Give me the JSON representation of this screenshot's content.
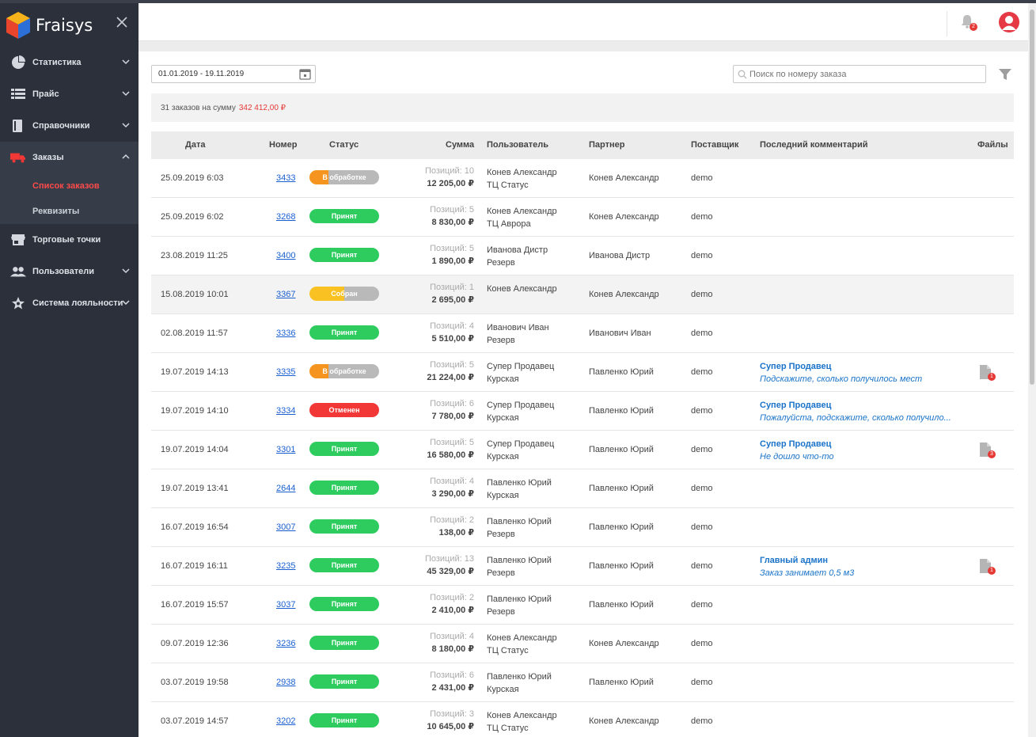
{
  "app": {
    "name": "Fraisys"
  },
  "colors": {
    "sidebar_bg": "#2b303b",
    "accent_red": "#e53935",
    "link_blue": "#1a5fd0",
    "status_green": "#2ecc5f",
    "status_red": "#f23737",
    "status_orange": "#f5941e",
    "status_yellow": "#f9c222"
  },
  "sidebar": {
    "items": [
      {
        "label": "Статистика",
        "icon": "pie-chart-icon"
      },
      {
        "label": "Прайс",
        "icon": "list-icon"
      },
      {
        "label": "Справочники",
        "icon": "book-icon"
      },
      {
        "label": "Заказы",
        "icon": "truck-icon"
      },
      {
        "label": "Торговые точки",
        "icon": "store-icon"
      },
      {
        "label": "Пользователи",
        "icon": "users-icon"
      },
      {
        "label": "Система лояльности",
        "icon": "star-icon"
      }
    ],
    "orders_sub": [
      {
        "label": "Список заказов"
      },
      {
        "label": "Реквизиты"
      }
    ]
  },
  "header": {
    "notification_count": "2"
  },
  "filters": {
    "date_range": "01.01.2019 - 19.11.2019",
    "search_placeholder": "Поиск по номеру заказа"
  },
  "summary": {
    "text": "31 заказов на сумму",
    "amount": "342 412,00 ₽"
  },
  "table": {
    "headers": {
      "date": "Дата",
      "number": "Номер",
      "status": "Статус",
      "sum": "Сумма",
      "user": "Пользователь",
      "partner": "Партнер",
      "supplier": "Поставщик",
      "comment": "Последний комментарий",
      "files": "Файлы"
    },
    "rows": [
      {
        "date": "25.09.2019 6:03",
        "number": "3433",
        "status": "В обработке",
        "status_type": "orange",
        "positions": "Позиций: 10",
        "sum": "12 205,00 ₽",
        "user": "Конев Александр",
        "user_store": "ТЦ Статус",
        "partner": "Конев Александр",
        "supplier": "demo",
        "comment_author": "",
        "comment_text": "",
        "files": ""
      },
      {
        "date": "25.09.2019 6:02",
        "number": "3268",
        "status": "Принят",
        "status_type": "green",
        "positions": "Позиций: 5",
        "sum": "8 830,00 ₽",
        "user": "Конев Александр",
        "user_store": "ТЦ Аврора",
        "partner": "Конев Александр",
        "supplier": "demo",
        "comment_author": "",
        "comment_text": "",
        "files": ""
      },
      {
        "date": "23.08.2019 11:25",
        "number": "3400",
        "status": "Принят",
        "status_type": "green",
        "positions": "Позиций: 5",
        "sum": "1 890,00 ₽",
        "user": "Иванова Дистр",
        "user_store": "Резерв",
        "partner": "Иванова Дистр",
        "supplier": "demo",
        "comment_author": "",
        "comment_text": "",
        "files": ""
      },
      {
        "date": "15.08.2019 10:01",
        "number": "3367",
        "status": "Собран",
        "status_type": "yellow",
        "positions": "Позиций: 1",
        "sum": "2 695,00 ₽",
        "user": "Конев Александр",
        "user_store": "",
        "partner": "Конев Александр",
        "supplier": "demo",
        "comment_author": "",
        "comment_text": "",
        "files": "",
        "hover": true
      },
      {
        "date": "02.08.2019 11:57",
        "number": "3336",
        "status": "Принят",
        "status_type": "green",
        "positions": "Позиций: 4",
        "sum": "5 510,00 ₽",
        "user": "Иванович Иван",
        "user_store": "Резерв",
        "partner": "Иванович Иван",
        "supplier": "demo",
        "comment_author": "",
        "comment_text": "",
        "files": ""
      },
      {
        "date": "19.07.2019 14:13",
        "number": "3335",
        "status": "В обработке",
        "status_type": "orange",
        "positions": "Позиций: 5",
        "sum": "21 224,00 ₽",
        "user": "Супер Продавец",
        "user_store": "Курская",
        "partner": "Павленко Юрий",
        "supplier": "demo",
        "comment_author": "Супер Продавец",
        "comment_text": "Подскажите, сколько получилось мест",
        "files": "1"
      },
      {
        "date": "19.07.2019 14:10",
        "number": "3334",
        "status": "Отменен",
        "status_type": "red",
        "positions": "Позиций: 6",
        "sum": "7 780,00 ₽",
        "user": "Супер Продавец",
        "user_store": "Курская",
        "partner": "Павленко Юрий",
        "supplier": "demo",
        "comment_author": "Супер Продавец",
        "comment_text": "Пожалуйста, подскажите, сколько получило...",
        "files": ""
      },
      {
        "date": "19.07.2019 14:04",
        "number": "3301",
        "status": "Принят",
        "status_type": "green",
        "positions": "Позиций: 5",
        "sum": "16 580,00 ₽",
        "user": "Супер Продавец",
        "user_store": "Курская",
        "partner": "Павленко Юрий",
        "supplier": "demo",
        "comment_author": "Супер Продавец",
        "comment_text": "Не дошло что-то",
        "files": "3"
      },
      {
        "date": "19.07.2019 13:41",
        "number": "2644",
        "status": "Принят",
        "status_type": "green",
        "positions": "Позиций: 4",
        "sum": "3 290,00 ₽",
        "user": "Павленко Юрий",
        "user_store": "Курская",
        "partner": "Павленко Юрий",
        "supplier": "demo",
        "comment_author": "",
        "comment_text": "",
        "files": ""
      },
      {
        "date": "16.07.2019 16:54",
        "number": "3007",
        "status": "Принят",
        "status_type": "green",
        "positions": "Позиций: 2",
        "sum": "138,00 ₽",
        "user": "Павленко Юрий",
        "user_store": "Резерв",
        "partner": "Павленко Юрий",
        "supplier": "demo",
        "comment_author": "",
        "comment_text": "",
        "files": ""
      },
      {
        "date": "16.07.2019 16:11",
        "number": "3235",
        "status": "Принят",
        "status_type": "green",
        "positions": "Позиций: 13",
        "sum": "45 329,00 ₽",
        "user": "Павленко Юрий",
        "user_store": "Резерв",
        "partner": "Павленко Юрий",
        "supplier": "demo",
        "comment_author": "Главный админ",
        "comment_text": "Заказ занимает 0,5 м3",
        "files": "1"
      },
      {
        "date": "16.07.2019 15:57",
        "number": "3037",
        "status": "Принят",
        "status_type": "green",
        "positions": "Позиций: 2",
        "sum": "2 410,00 ₽",
        "user": "Павленко Юрий",
        "user_store": "Резерв",
        "partner": "Павленко Юрий",
        "supplier": "demo",
        "comment_author": "",
        "comment_text": "",
        "files": ""
      },
      {
        "date": "09.07.2019 12:36",
        "number": "3236",
        "status": "Принят",
        "status_type": "green",
        "positions": "Позиций: 4",
        "sum": "8 180,00 ₽",
        "user": "Конев Александр",
        "user_store": "ТЦ Статус",
        "partner": "Конев Александр",
        "supplier": "demo",
        "comment_author": "",
        "comment_text": "",
        "files": ""
      },
      {
        "date": "03.07.2019 19:58",
        "number": "2938",
        "status": "Принят",
        "status_type": "green",
        "positions": "Позиций: 6",
        "sum": "2 431,00 ₽",
        "user": "Павленко Юрий",
        "user_store": "Курская",
        "partner": "Павленко Юрий",
        "supplier": "demo",
        "comment_author": "",
        "comment_text": "",
        "files": ""
      },
      {
        "date": "03.07.2019 14:57",
        "number": "3202",
        "status": "Принят",
        "status_type": "green",
        "positions": "Позиций: 3",
        "sum": "10 645,00 ₽",
        "user": "Конев Александр",
        "user_store": "ТЦ Статус",
        "partner": "Конев Александр",
        "supplier": "demo",
        "comment_author": "",
        "comment_text": "",
        "files": ""
      }
    ]
  }
}
